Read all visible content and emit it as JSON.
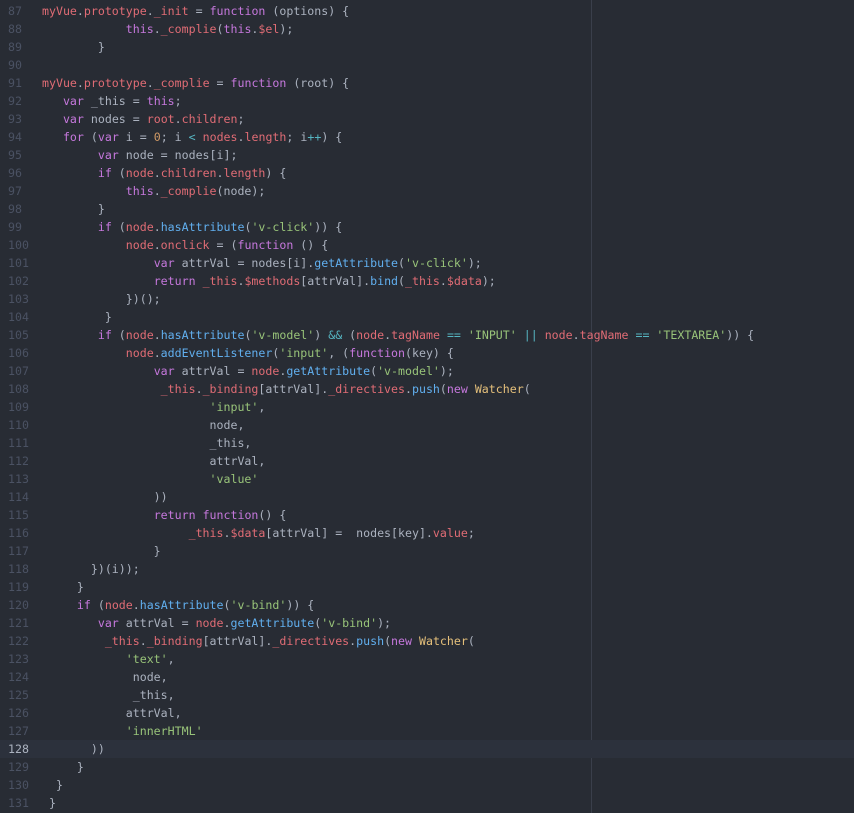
{
  "editor": {
    "current_line": 128,
    "lines": [
      {
        "num": "87",
        "tokens": [
          [
            "p",
            "myVue"
          ],
          [
            "t",
            "."
          ],
          [
            "p",
            "prototype"
          ],
          [
            "t",
            "."
          ],
          [
            "p",
            "_init"
          ],
          [
            "t",
            " = "
          ],
          [
            "k",
            "function"
          ],
          [
            "t",
            " (options) {"
          ]
        ]
      },
      {
        "num": "88",
        "tokens": [
          [
            "t",
            "            "
          ],
          [
            "k",
            "this"
          ],
          [
            "t",
            "."
          ],
          [
            "p",
            "_complie"
          ],
          [
            "t",
            "("
          ],
          [
            "k",
            "this"
          ],
          [
            "t",
            "."
          ],
          [
            "p",
            "$el"
          ],
          [
            "t",
            ");"
          ]
        ]
      },
      {
        "num": "89",
        "tokens": [
          [
            "t",
            "        }"
          ]
        ]
      },
      {
        "num": "90",
        "tokens": []
      },
      {
        "num": "91",
        "tokens": [
          [
            "p",
            "myVue"
          ],
          [
            "t",
            "."
          ],
          [
            "p",
            "prototype"
          ],
          [
            "t",
            "."
          ],
          [
            "p",
            "_complie"
          ],
          [
            "t",
            " = "
          ],
          [
            "k",
            "function"
          ],
          [
            "t",
            " (root) {"
          ]
        ]
      },
      {
        "num": "92",
        "tokens": [
          [
            "t",
            "   "
          ],
          [
            "k",
            "var"
          ],
          [
            "t",
            " _this = "
          ],
          [
            "k",
            "this"
          ],
          [
            "t",
            ";"
          ]
        ]
      },
      {
        "num": "93",
        "tokens": [
          [
            "t",
            "   "
          ],
          [
            "k",
            "var"
          ],
          [
            "t",
            " nodes = "
          ],
          [
            "p",
            "root"
          ],
          [
            "t",
            "."
          ],
          [
            "p",
            "children"
          ],
          [
            "t",
            ";"
          ]
        ]
      },
      {
        "num": "94",
        "tokens": [
          [
            "t",
            "   "
          ],
          [
            "k",
            "for"
          ],
          [
            "t",
            " ("
          ],
          [
            "k",
            "var"
          ],
          [
            "t",
            " i = "
          ],
          [
            "n",
            "0"
          ],
          [
            "t",
            "; i "
          ],
          [
            "o",
            "<"
          ],
          [
            "t",
            " "
          ],
          [
            "p",
            "nodes"
          ],
          [
            "t",
            "."
          ],
          [
            "p",
            "length"
          ],
          [
            "t",
            "; i"
          ],
          [
            "o",
            "++"
          ],
          [
            "t",
            ") {"
          ]
        ]
      },
      {
        "num": "95",
        "tokens": [
          [
            "t",
            "        "
          ],
          [
            "k",
            "var"
          ],
          [
            "t",
            " node = nodes[i];"
          ]
        ]
      },
      {
        "num": "96",
        "tokens": [
          [
            "t",
            "        "
          ],
          [
            "k",
            "if"
          ],
          [
            "t",
            " ("
          ],
          [
            "p",
            "node"
          ],
          [
            "t",
            "."
          ],
          [
            "p",
            "children"
          ],
          [
            "t",
            "."
          ],
          [
            "p",
            "length"
          ],
          [
            "t",
            ") {"
          ]
        ]
      },
      {
        "num": "97",
        "tokens": [
          [
            "t",
            "            "
          ],
          [
            "k",
            "this"
          ],
          [
            "t",
            "."
          ],
          [
            "p",
            "_complie"
          ],
          [
            "t",
            "(node);"
          ]
        ]
      },
      {
        "num": "98",
        "tokens": [
          [
            "t",
            "        }"
          ]
        ]
      },
      {
        "num": "99",
        "tokens": [
          [
            "t",
            "        "
          ],
          [
            "k",
            "if"
          ],
          [
            "t",
            " ("
          ],
          [
            "p",
            "node"
          ],
          [
            "t",
            "."
          ],
          [
            "f",
            "hasAttribute"
          ],
          [
            "t",
            "("
          ],
          [
            "s",
            "'v-click'"
          ],
          [
            "t",
            ")) {"
          ]
        ]
      },
      {
        "num": "100",
        "tokens": [
          [
            "t",
            "            "
          ],
          [
            "p",
            "node"
          ],
          [
            "t",
            "."
          ],
          [
            "p",
            "onclick"
          ],
          [
            "t",
            " = ("
          ],
          [
            "k",
            "function"
          ],
          [
            "t",
            " () {"
          ]
        ]
      },
      {
        "num": "101",
        "tokens": [
          [
            "t",
            "                "
          ],
          [
            "k",
            "var"
          ],
          [
            "t",
            " attrVal = nodes[i]."
          ],
          [
            "f",
            "getAttribute"
          ],
          [
            "t",
            "("
          ],
          [
            "s",
            "'v-click'"
          ],
          [
            "t",
            ");"
          ]
        ]
      },
      {
        "num": "102",
        "tokens": [
          [
            "t",
            "                "
          ],
          [
            "k",
            "return"
          ],
          [
            "t",
            " "
          ],
          [
            "p",
            "_this"
          ],
          [
            "t",
            "."
          ],
          [
            "p",
            "$methods"
          ],
          [
            "t",
            "[attrVal]."
          ],
          [
            "f",
            "bind"
          ],
          [
            "t",
            "("
          ],
          [
            "p",
            "_this"
          ],
          [
            "t",
            "."
          ],
          [
            "p",
            "$data"
          ],
          [
            "t",
            ");"
          ]
        ]
      },
      {
        "num": "103",
        "tokens": [
          [
            "t",
            "            })();"
          ]
        ]
      },
      {
        "num": "104",
        "tokens": [
          [
            "t",
            "         }"
          ]
        ]
      },
      {
        "num": "105",
        "tokens": [
          [
            "t",
            "        "
          ],
          [
            "k",
            "if"
          ],
          [
            "t",
            " ("
          ],
          [
            "p",
            "node"
          ],
          [
            "t",
            "."
          ],
          [
            "f",
            "hasAttribute"
          ],
          [
            "t",
            "("
          ],
          [
            "s",
            "'v-model'"
          ],
          [
            "t",
            ") "
          ],
          [
            "o",
            "&&"
          ],
          [
            "t",
            " ("
          ],
          [
            "p",
            "node"
          ],
          [
            "t",
            "."
          ],
          [
            "p",
            "tagName"
          ],
          [
            "t",
            " "
          ],
          [
            "o",
            "=="
          ],
          [
            "t",
            " "
          ],
          [
            "s",
            "'INPUT'"
          ],
          [
            "t",
            " "
          ],
          [
            "o",
            "||"
          ],
          [
            "t",
            " "
          ],
          [
            "p",
            "node"
          ],
          [
            "t",
            "."
          ],
          [
            "p",
            "tagName"
          ],
          [
            "t",
            " "
          ],
          [
            "o",
            "=="
          ],
          [
            "t",
            " "
          ],
          [
            "s",
            "'TEXTAREA'"
          ],
          [
            "t",
            ")) {"
          ]
        ]
      },
      {
        "num": "106",
        "tokens": [
          [
            "t",
            "            "
          ],
          [
            "p",
            "node"
          ],
          [
            "t",
            "."
          ],
          [
            "f",
            "addEventListener"
          ],
          [
            "t",
            "("
          ],
          [
            "s",
            "'input'"
          ],
          [
            "t",
            ", ("
          ],
          [
            "k",
            "function"
          ],
          [
            "t",
            "(key) {"
          ]
        ]
      },
      {
        "num": "107",
        "tokens": [
          [
            "t",
            "                "
          ],
          [
            "k",
            "var"
          ],
          [
            "t",
            " attrVal = "
          ],
          [
            "p",
            "node"
          ],
          [
            "t",
            "."
          ],
          [
            "f",
            "getAttribute"
          ],
          [
            "t",
            "("
          ],
          [
            "s",
            "'v-model'"
          ],
          [
            "t",
            ");"
          ]
        ]
      },
      {
        "num": "108",
        "tokens": [
          [
            "t",
            "                 "
          ],
          [
            "p",
            "_this"
          ],
          [
            "t",
            "."
          ],
          [
            "p",
            "_binding"
          ],
          [
            "t",
            "[attrVal]."
          ],
          [
            "p",
            "_directives"
          ],
          [
            "t",
            "."
          ],
          [
            "f",
            "push"
          ],
          [
            "t",
            "("
          ],
          [
            "k",
            "new"
          ],
          [
            "t",
            " "
          ],
          [
            "c",
            "Watcher"
          ],
          [
            "t",
            "("
          ]
        ]
      },
      {
        "num": "109",
        "tokens": [
          [
            "t",
            "                        "
          ],
          [
            "s",
            "'input'"
          ],
          [
            "t",
            ","
          ]
        ]
      },
      {
        "num": "110",
        "tokens": [
          [
            "t",
            "                        node,"
          ]
        ]
      },
      {
        "num": "111",
        "tokens": [
          [
            "t",
            "                        _this,"
          ]
        ]
      },
      {
        "num": "112",
        "tokens": [
          [
            "t",
            "                        attrVal,"
          ]
        ]
      },
      {
        "num": "113",
        "tokens": [
          [
            "t",
            "                        "
          ],
          [
            "s",
            "'value'"
          ]
        ]
      },
      {
        "num": "114",
        "tokens": [
          [
            "t",
            "                ))"
          ]
        ]
      },
      {
        "num": "115",
        "tokens": [
          [
            "t",
            "                "
          ],
          [
            "k",
            "return"
          ],
          [
            "t",
            " "
          ],
          [
            "k",
            "function"
          ],
          [
            "t",
            "() {"
          ]
        ]
      },
      {
        "num": "116",
        "tokens": [
          [
            "t",
            "                     "
          ],
          [
            "p",
            "_this"
          ],
          [
            "t",
            "."
          ],
          [
            "p",
            "$data"
          ],
          [
            "t",
            "[attrVal] =  nodes[key]."
          ],
          [
            "p",
            "value"
          ],
          [
            "t",
            ";"
          ]
        ]
      },
      {
        "num": "117",
        "tokens": [
          [
            "t",
            "                }"
          ]
        ]
      },
      {
        "num": "118",
        "tokens": [
          [
            "t",
            "       })(i));"
          ]
        ]
      },
      {
        "num": "119",
        "tokens": [
          [
            "t",
            "     }"
          ]
        ]
      },
      {
        "num": "120",
        "tokens": [
          [
            "t",
            "     "
          ],
          [
            "k",
            "if"
          ],
          [
            "t",
            " ("
          ],
          [
            "p",
            "node"
          ],
          [
            "t",
            "."
          ],
          [
            "f",
            "hasAttribute"
          ],
          [
            "t",
            "("
          ],
          [
            "s",
            "'v-bind'"
          ],
          [
            "t",
            ")) {"
          ]
        ]
      },
      {
        "num": "121",
        "tokens": [
          [
            "t",
            "        "
          ],
          [
            "k",
            "var"
          ],
          [
            "t",
            " attrVal = "
          ],
          [
            "p",
            "node"
          ],
          [
            "t",
            "."
          ],
          [
            "f",
            "getAttribute"
          ],
          [
            "t",
            "("
          ],
          [
            "s",
            "'v-bind'"
          ],
          [
            "t",
            ");"
          ]
        ]
      },
      {
        "num": "122",
        "tokens": [
          [
            "t",
            "         "
          ],
          [
            "p",
            "_this"
          ],
          [
            "t",
            "."
          ],
          [
            "p",
            "_binding"
          ],
          [
            "t",
            "[attrVal]."
          ],
          [
            "p",
            "_directives"
          ],
          [
            "t",
            "."
          ],
          [
            "f",
            "push"
          ],
          [
            "t",
            "("
          ],
          [
            "k",
            "new"
          ],
          [
            "t",
            " "
          ],
          [
            "c",
            "Watcher"
          ],
          [
            "t",
            "("
          ]
        ]
      },
      {
        "num": "123",
        "tokens": [
          [
            "t",
            "            "
          ],
          [
            "s",
            "'text'"
          ],
          [
            "t",
            ","
          ]
        ]
      },
      {
        "num": "124",
        "tokens": [
          [
            "t",
            "             node,"
          ]
        ]
      },
      {
        "num": "125",
        "tokens": [
          [
            "t",
            "             _this,"
          ]
        ]
      },
      {
        "num": "126",
        "tokens": [
          [
            "t",
            "            attrVal,"
          ]
        ]
      },
      {
        "num": "127",
        "tokens": [
          [
            "t",
            "            "
          ],
          [
            "s",
            "'innerHTML'"
          ]
        ]
      },
      {
        "num": "128",
        "tokens": [
          [
            "t",
            "       ))"
          ]
        ]
      },
      {
        "num": "129",
        "tokens": [
          [
            "t",
            "     }"
          ]
        ]
      },
      {
        "num": "130",
        "tokens": [
          [
            "t",
            "  }"
          ]
        ]
      },
      {
        "num": "131",
        "tokens": [
          [
            "t",
            " }"
          ]
        ]
      }
    ]
  }
}
